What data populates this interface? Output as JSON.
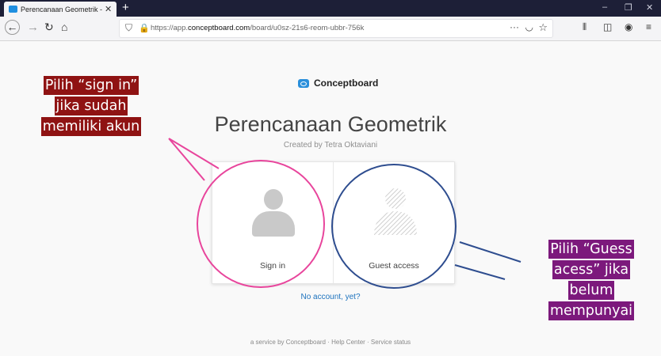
{
  "browser": {
    "tab_title": "Perencanaan Geometrik - Con",
    "url_host": "https://app.",
    "url_domain": "conceptboard.com",
    "url_path": "/board/u0sz-21s6-reom-ubbr-756k",
    "colors": {
      "titlebar": "#1d1f37",
      "accent": "#1f8fe0"
    }
  },
  "page": {
    "brand": "Conceptboard",
    "board_title": "Perencanaan Geometrik",
    "subtitle": "Created by Tetra Oktaviani",
    "signin_label": "Sign in",
    "guest_label": "Guest access",
    "no_account": "No account, yet?",
    "footer": "a service by Conceptboard  ·  Help Center  ·  Service status"
  },
  "annotations": {
    "left": {
      "lines": [
        "Pilih “sign in”",
        "jika sudah",
        "memiliki akun"
      ],
      "color": "#8f1313",
      "circle_color": "#e8459c"
    },
    "right": {
      "lines": [
        "Pilih “Guess",
        "acess” jika",
        "belum",
        "mempunyai"
      ],
      "color": "#7c197c",
      "circle_color": "#2e4d8f"
    }
  }
}
